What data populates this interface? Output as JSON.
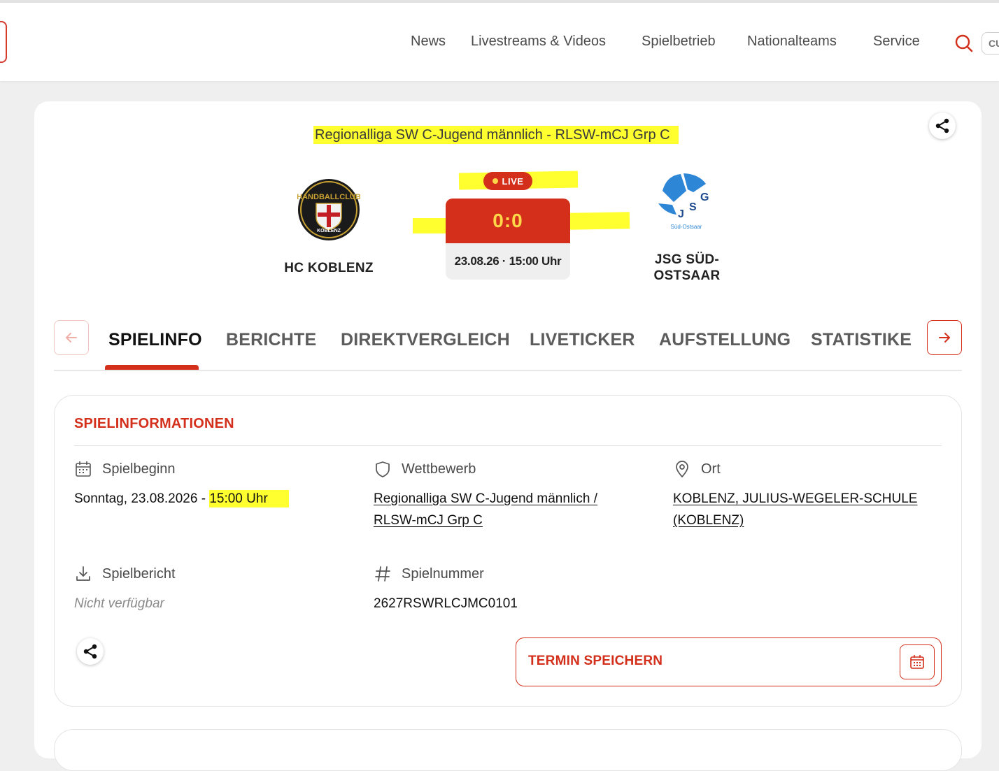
{
  "header": {
    "nav": [
      "News",
      "Livestreams & Videos",
      "Spielbetrieb",
      "Nationalteams",
      "Service"
    ],
    "search_button_label": "CU"
  },
  "match": {
    "league": "Regionalliga SW C-Jugend männlich - RLSW-mCJ Grp C",
    "home_team": "HC KOBLENZ",
    "away_team_line1": "JSG SÜD-",
    "away_team_line2": "OSTSAAR",
    "live_label": "LIVE",
    "score": "0:0",
    "datetime": "23.08.26 · 15:00 Uhr",
    "home_logo_text_top": "HANDBALLCLUB",
    "home_logo_text_bottom": "KOBLENZ",
    "away_logo_text": "JSG",
    "away_logo_subtext": "Süd-Ostsaar"
  },
  "tabs": [
    "SPIELINFO",
    "BERICHTE",
    "DIREKTVERGLEICH",
    "LIVETICKER",
    "AUFSTELLUNG",
    "STATISTIKEN"
  ],
  "active_tab": "SPIELINFO",
  "info": {
    "title": "SPIELINFORMATIONEN",
    "spielbeginn_label": "Spielbeginn",
    "spielbeginn_date": "Sonntag, 23.08.2026",
    "spielbeginn_sep": " - ",
    "spielbeginn_time": "15:00 Uhr",
    "wettbewerb_label": "Wettbewerb",
    "wettbewerb_line1": "Regionalliga SW C-Jugend männlich /",
    "wettbewerb_line2": "RLSW-mCJ Grp C",
    "ort_label": "Ort",
    "ort_line1": "KOBLENZ, JULIUS-WEGELER-SCHULE",
    "ort_line2": "(KOBLENZ)",
    "spielbericht_label": "Spielbericht",
    "spielbericht_value": "Nicht verfügbar",
    "spielnummer_label": "Spielnummer",
    "spielnummer_value": "2627RSWRLCJMC0101",
    "termin_label": "TERMIN SPEICHERN"
  },
  "colors": {
    "accent": "#d32f1b",
    "highlight": "#ffff30",
    "score_text": "#ffd84a"
  },
  "icons": [
    "search-icon",
    "share-icon",
    "arrow-left-icon",
    "arrow-right-icon",
    "calendar-icon",
    "shield-icon",
    "location-pin-icon",
    "download-icon",
    "hash-icon"
  ]
}
